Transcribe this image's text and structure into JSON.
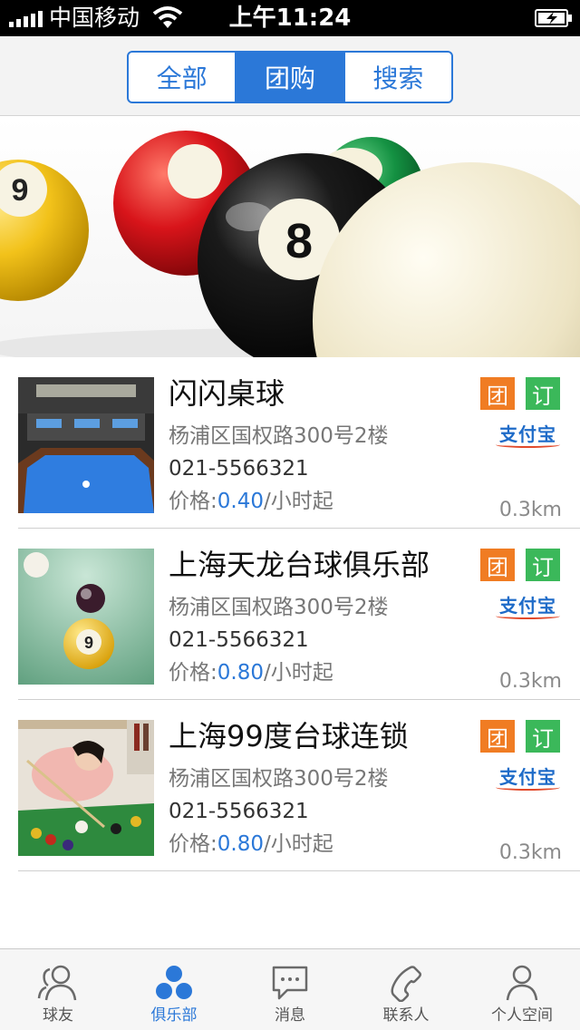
{
  "status_bar": {
    "carrier": "中国移动",
    "time": "上午11:24"
  },
  "header": {
    "tabs": [
      {
        "label": "全部",
        "active": false
      },
      {
        "label": "团购",
        "active": true
      },
      {
        "label": "搜索",
        "active": false
      }
    ]
  },
  "clubs": [
    {
      "name": "闪闪桌球",
      "address": "杨浦区国权路300号2楼",
      "phone": "021-5566321",
      "price_label": "价格:",
      "price": "0.40",
      "price_unit": "/小时起",
      "distance": "0.3km",
      "badge_group": "团",
      "badge_book": "订",
      "payment": "支付宝"
    },
    {
      "name": "上海天龙台球俱乐部",
      "address": "杨浦区国权路300号2楼",
      "phone": "021-5566321",
      "price_label": "价格:",
      "price": "0.80",
      "price_unit": "/小时起",
      "distance": "0.3km",
      "badge_group": "团",
      "badge_book": "订",
      "payment": "支付宝"
    },
    {
      "name": "上海99度台球连锁",
      "address": "杨浦区国权路300号2楼",
      "phone": "021-5566321",
      "price_label": "价格:",
      "price": "0.80",
      "price_unit": "/小时起",
      "distance": "0.3km",
      "badge_group": "团",
      "badge_book": "订",
      "payment": "支付宝"
    }
  ],
  "tab_bar": {
    "items": [
      {
        "label": "球友",
        "icon": "friends-icon",
        "active": false
      },
      {
        "label": "俱乐部",
        "icon": "club-icon",
        "active": true
      },
      {
        "label": "消息",
        "icon": "message-icon",
        "active": false
      },
      {
        "label": "联系人",
        "icon": "phone-icon",
        "active": false
      },
      {
        "label": "个人空间",
        "icon": "person-icon",
        "active": false
      }
    ]
  },
  "colors": {
    "accent": "#2b78d8",
    "badge_group": "#f07c23",
    "badge_book": "#3bb85a"
  }
}
